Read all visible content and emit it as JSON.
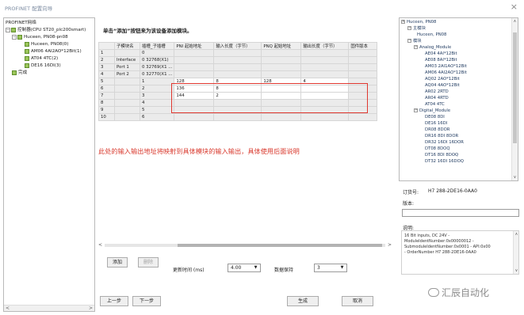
{
  "window": {
    "title": "PROFINET 配置向导",
    "close": "×"
  },
  "tree": [
    {
      "label": "PROFINET网络",
      "indent": 0,
      "icon": "none",
      "exp": ""
    },
    {
      "label": "控制器(CPU ST20_plc200smart)",
      "indent": 0,
      "icon": "green",
      "exp": "−"
    },
    {
      "label": "Huceen, PN08-pn08",
      "indent": 8,
      "icon": "green",
      "exp": "−"
    },
    {
      "label": "Huceen, PN08(0)",
      "indent": 24,
      "icon": "green",
      "exp": ""
    },
    {
      "label": "AM06 4AI2AO*12Bit(1)",
      "indent": 24,
      "icon": "green",
      "exp": ""
    },
    {
      "label": "AT04 4TC(2)",
      "indent": 24,
      "icon": "green",
      "exp": ""
    },
    {
      "label": "DE16 16DI(3)",
      "indent": 24,
      "icon": "green",
      "exp": ""
    },
    {
      "label": "完成",
      "indent": 8,
      "icon": "green",
      "exp": ""
    }
  ],
  "heading": "单击“添加”按钮来为该设备添加模块。",
  "table": {
    "headers": [
      "",
      "子模块名",
      "插槽_子插槽",
      "PNI 起始地址",
      "输入长度（字节）",
      "PNQ 起始地址",
      "输出长度（字节）",
      "固件版本"
    ],
    "rows": [
      [
        "1",
        "",
        "0",
        "",
        "",
        "",
        "",
        ""
      ],
      [
        "2",
        "Interface",
        "0 32768(X1)",
        "",
        "",
        "",
        "",
        ""
      ],
      [
        "3",
        "Port 1",
        "0 32769(X1 ...",
        "",
        "",
        "",
        "",
        ""
      ],
      [
        "4",
        "Port 2",
        "0 32770(X1 ...",
        "",
        "",
        "",
        "",
        ""
      ],
      [
        "5",
        "",
        "1",
        "128",
        "8",
        "128",
        "4",
        ""
      ],
      [
        "6",
        "",
        "2",
        "136",
        "8",
        "",
        "",
        ""
      ],
      [
        "7",
        "",
        "3",
        "144",
        "2",
        "",
        "",
        ""
      ],
      [
        "8",
        "",
        "4",
        "",
        "",
        "",
        "",
        ""
      ],
      [
        "9",
        "",
        "5",
        "",
        "",
        "",
        "",
        ""
      ],
      [
        "10",
        "",
        "6",
        "",
        "",
        "",
        "",
        ""
      ]
    ]
  },
  "annotation": "此处的输入输出地址将映射到具体模块的输入输出，具体使用后面说明",
  "buttons": {
    "add": "添加",
    "delete": "删除",
    "prev": "上一步",
    "next": "下一步",
    "finish": "生成",
    "cancel": "取消"
  },
  "update_time": {
    "label": "更新时间 (ms)",
    "value": "4.00"
  },
  "data_hold": {
    "label": "数据保持",
    "value": "3"
  },
  "catalog": [
    {
      "label": "Huceen, PN08",
      "indent": 2,
      "exp": "∧"
    },
    {
      "label": "主模块",
      "indent": 10,
      "exp": "−"
    },
    {
      "label": "Huceen, PN08",
      "indent": 22,
      "exp": ""
    },
    {
      "label": "模块",
      "indent": 10,
      "exp": "−"
    },
    {
      "label": "Analog_Module",
      "indent": 18,
      "exp": "−"
    },
    {
      "label": "AE04 4AI*12Bit",
      "indent": 32,
      "exp": ""
    },
    {
      "label": "AE08 8AI*12Bit",
      "indent": 32,
      "exp": ""
    },
    {
      "label": "AM03 2AI1AO*12Bit",
      "indent": 32,
      "exp": ""
    },
    {
      "label": "AM06 4AI2AO*12Bit",
      "indent": 32,
      "exp": ""
    },
    {
      "label": "AQ02 2AO*12Bit",
      "indent": 32,
      "exp": ""
    },
    {
      "label": "AQ04 4AO*12Bit",
      "indent": 32,
      "exp": ""
    },
    {
      "label": "AR02 2RTD",
      "indent": 32,
      "exp": ""
    },
    {
      "label": "AR04 4RTD",
      "indent": 32,
      "exp": ""
    },
    {
      "label": "AT04 4TC",
      "indent": 32,
      "exp": ""
    },
    {
      "label": "Digital_Module",
      "indent": 18,
      "exp": "−"
    },
    {
      "label": "DE08 8DI",
      "indent": 32,
      "exp": ""
    },
    {
      "label": "DE16 16DI",
      "indent": 32,
      "exp": ""
    },
    {
      "label": "DR08 8DOR",
      "indent": 32,
      "exp": ""
    },
    {
      "label": "DR16 8DI 8DOR",
      "indent": 32,
      "exp": ""
    },
    {
      "label": "DR32 16DI 16DOR",
      "indent": 32,
      "exp": ""
    },
    {
      "label": "DT08 8DOQ",
      "indent": 32,
      "exp": ""
    },
    {
      "label": "DT16 8DI 8DOQ",
      "indent": 32,
      "exp": ""
    },
    {
      "label": "DT32 16DI 16DOQ",
      "indent": 32,
      "exp": ""
    }
  ],
  "details": {
    "order_label": "订货号:",
    "order_value": "H7 288-2DE16-0AA0",
    "version_label": "版本:",
    "version_value": "",
    "desc_label": "说明:",
    "desc_lines": [
      "16 Bit inputs, DC 24V -",
      "ModuleIdentNumber:0x00000012 -",
      "SubmoduleIdentNumber:0x0001 - API:0x00",
      "- OrderNumber H7 288-2DE16-0AA0"
    ]
  },
  "watermark": "汇辰自动化",
  "colors": {
    "annotation": "#d93a2e",
    "highlight_box": "#e0372f",
    "module_icon": "#9bc55a"
  }
}
